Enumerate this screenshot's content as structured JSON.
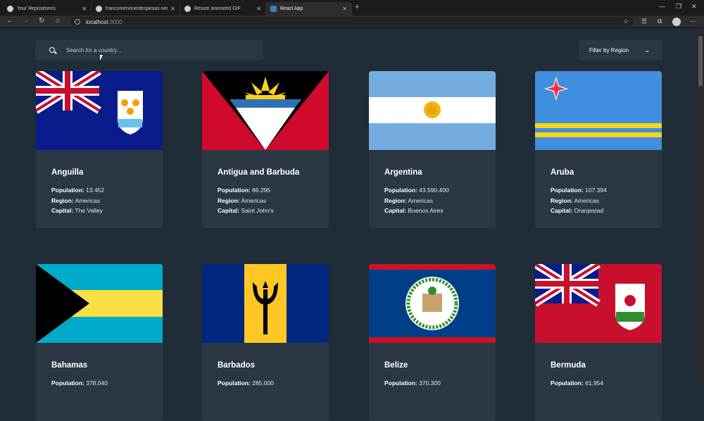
{
  "browser": {
    "tabs": [
      {
        "label": "Your Repositories",
        "active": false
      },
      {
        "label": "francomenone/despesas-sensacio...",
        "active": false
      },
      {
        "label": "Resize animated GIF",
        "active": false
      },
      {
        "label": "React App",
        "active": true
      }
    ],
    "address": {
      "host": "localhost",
      "port": ":3000"
    }
  },
  "toolbar": {
    "search_placeholder": "Search for a country...",
    "filter_label": "Filter by Region"
  },
  "labels": {
    "population": "Population:",
    "region": "Region:",
    "capital": "Capital:"
  },
  "countries": [
    {
      "name": "Anguilla",
      "population": "13.452",
      "region": "Americas",
      "capital": "The Valley",
      "flag": "anguilla-flag"
    },
    {
      "name": "Antigua and Barbuda",
      "population": "86.295",
      "region": "Americas",
      "capital": "Saint John's",
      "flag": "antigua-flag"
    },
    {
      "name": "Argentina",
      "population": "43.590.400",
      "region": "Americas",
      "capital": "Buenos Aires",
      "flag": "argentina-flag"
    },
    {
      "name": "Aruba",
      "population": "107.394",
      "region": "Americas",
      "capital": "Oranjestad",
      "flag": "aruba-flag"
    },
    {
      "name": "Bahamas",
      "population": "378.040",
      "flag": "bahamas-flag"
    },
    {
      "name": "Barbados",
      "population": "285.000",
      "flag": "barbados-flag"
    },
    {
      "name": "Belize",
      "population": "370.300",
      "flag": "belize-flag"
    },
    {
      "name": "Bermuda",
      "population": "61.954",
      "flag": "bermuda-flag"
    }
  ],
  "colors": {
    "background": "#202c37",
    "element": "#2b3844",
    "text": "#ffffff"
  }
}
